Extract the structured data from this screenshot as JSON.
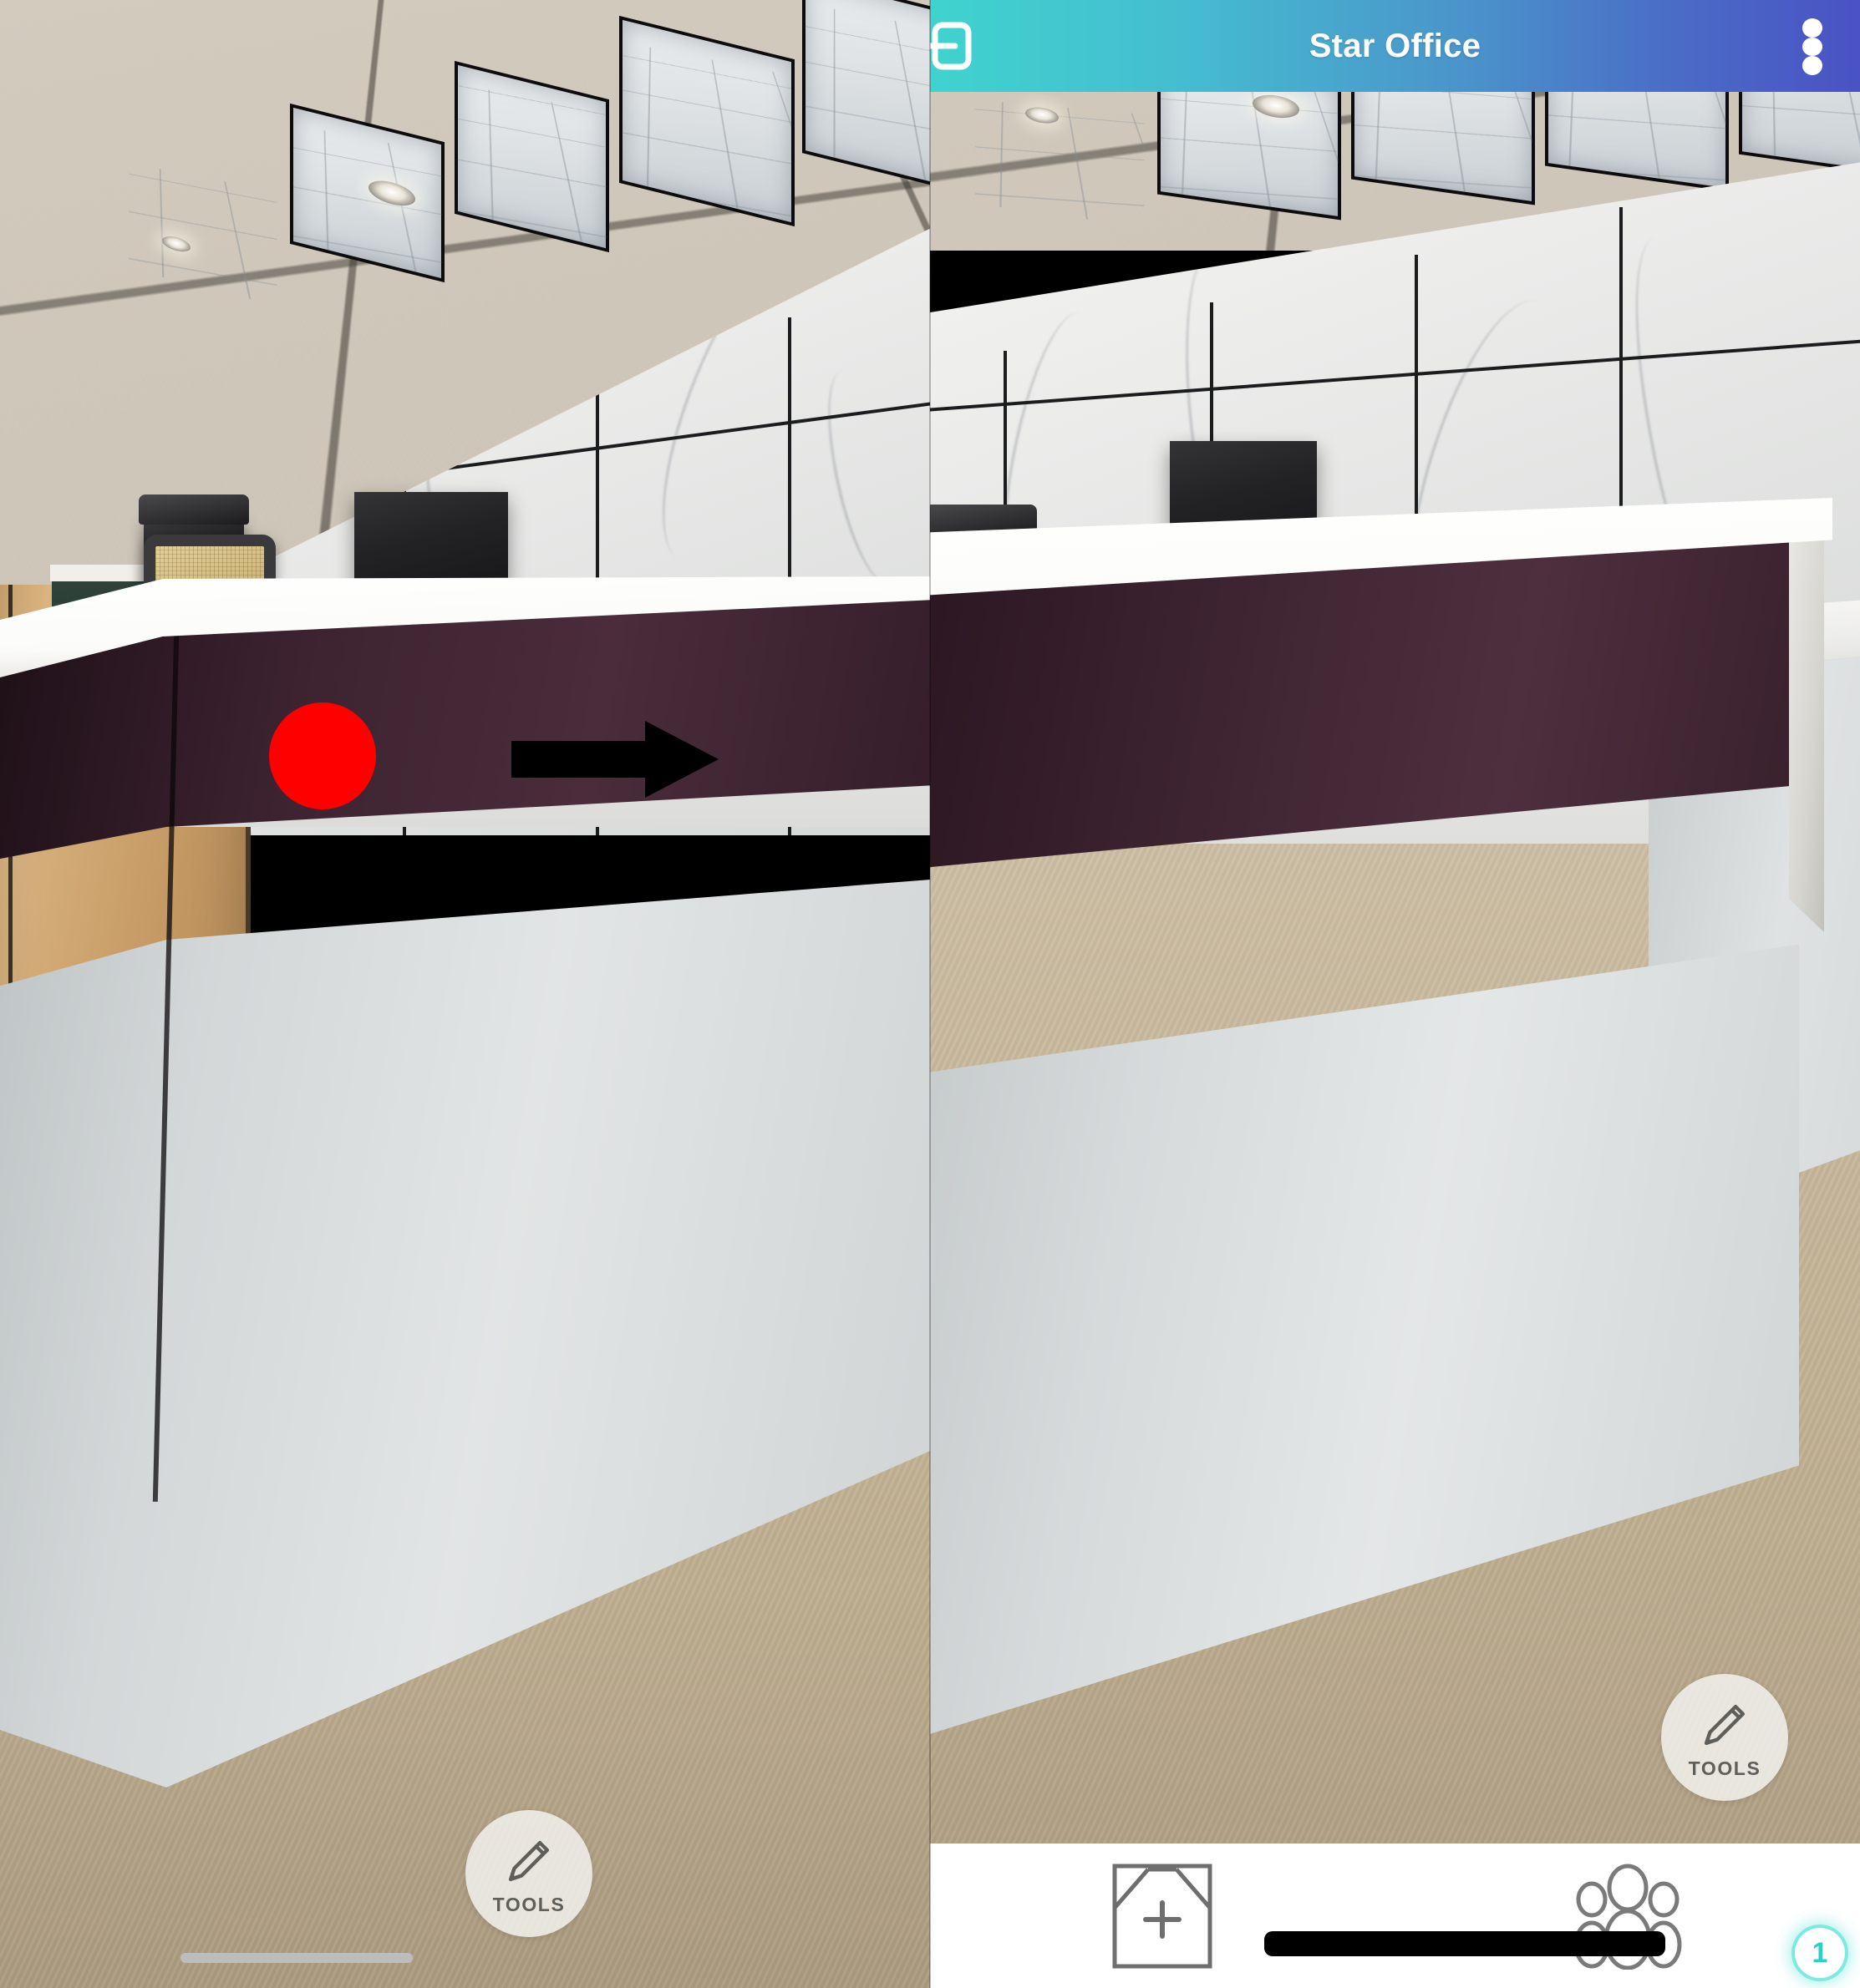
{
  "app": {
    "title": "Star Office",
    "header": {
      "gradient_start": "#3fd3ce",
      "gradient_end": "#4a52c4",
      "exit_icon": "exit-icon",
      "overflow_icon": "three-dot-menu-icon"
    }
  },
  "tools_fab": {
    "label": "TOOLS",
    "icon": "pencil-icon"
  },
  "bottom_nav": {
    "items": [
      {
        "icon": "add-room-icon",
        "label": ""
      },
      {
        "icon": "people-group-icon",
        "label": "",
        "badge": "1"
      }
    ],
    "badge_color": "#2fd0c4",
    "background": "#ffffff"
  },
  "annotations": [
    {
      "type": "circle",
      "color": "#ff0000",
      "name": "red-circle-annotation"
    },
    {
      "type": "arrow",
      "color": "#000000",
      "direction": "right",
      "name": "black-arrow-annotation"
    }
  ],
  "scene": {
    "name": "office-reception-desk",
    "panels": [
      {
        "name": "left-photo-panel",
        "has_app_chrome": false
      },
      {
        "name": "right-photo-panel",
        "has_app_chrome": true
      }
    ],
    "colors": {
      "ceiling": "#cdc6b8",
      "wood_wall": "#c79c66",
      "marble_wall": "#ecece9",
      "desk_top": "#fdfdfb",
      "desk_band": "#3a1f2b",
      "desk_panel": "#d7dadb",
      "carpet": "#7d7464"
    }
  },
  "home_indicator": {
    "left_color": "#bdbdbd",
    "right_color": "#000000"
  }
}
